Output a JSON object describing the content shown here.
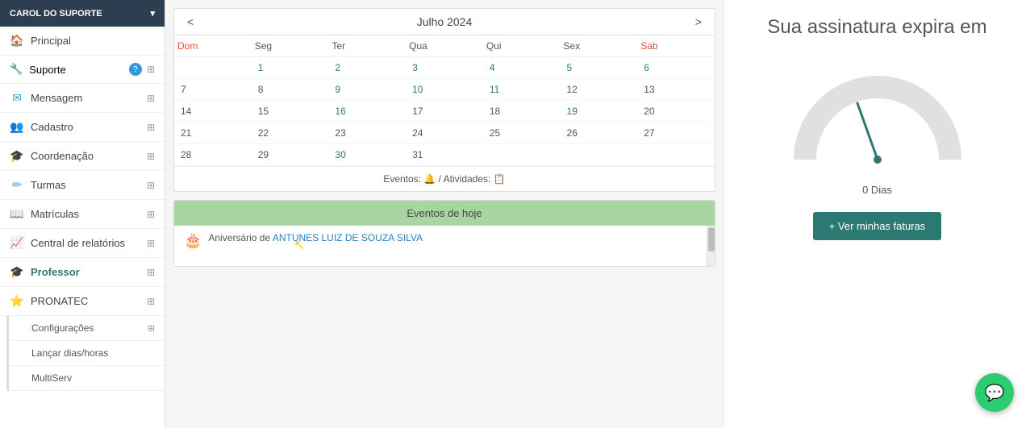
{
  "sidebar": {
    "user": {
      "name": "CAROL DO SUPORTE",
      "chevron": "▾"
    },
    "items": [
      {
        "id": "principal",
        "label": "Principal",
        "icon": "🏠",
        "expandable": false
      },
      {
        "id": "suporte",
        "label": "Suporte",
        "icon": "❓",
        "expandable": true
      },
      {
        "id": "mensagem",
        "label": "Mensagem",
        "icon": "✉",
        "expandable": true
      },
      {
        "id": "cadastro",
        "label": "Cadastro",
        "icon": "👥",
        "expandable": true
      },
      {
        "id": "coordenacao",
        "label": "Coordenação",
        "icon": "🎓",
        "expandable": true
      },
      {
        "id": "turmas",
        "label": "Turmas",
        "icon": "✏",
        "expandable": true
      },
      {
        "id": "matriculas",
        "label": "Matrículas",
        "icon": "📖",
        "expandable": true
      },
      {
        "id": "relatorios",
        "label": "Central de relatórios",
        "icon": "📈",
        "expandable": true
      },
      {
        "id": "professor",
        "label": "Professor",
        "icon": "🎓",
        "expandable": true
      },
      {
        "id": "pronatec",
        "label": "PRONATEC",
        "icon": "⭐",
        "expandable": true
      }
    ],
    "sub_items": [
      {
        "id": "configuracoes",
        "label": "Configurações",
        "expandable": true
      },
      {
        "id": "lancar-dias",
        "label": "Lançar dias/horas",
        "expandable": false
      },
      {
        "id": "multiserv",
        "label": "MultiServ",
        "expandable": false
      }
    ]
  },
  "calendar": {
    "title": "Julho 2024",
    "prev": "<",
    "next": ">",
    "days": [
      "Dom",
      "Seg",
      "Ter",
      "Qua",
      "Qui",
      "Sex",
      "Sab"
    ],
    "weeks": [
      [
        "",
        "1",
        "2",
        "3",
        "4",
        "5",
        "6"
      ],
      [
        "7",
        "8",
        "9",
        "10",
        "11",
        "12",
        "13"
      ],
      [
        "14",
        "15",
        "16",
        "17",
        "18",
        "19",
        "20"
      ],
      [
        "21",
        "22",
        "23",
        "24",
        "25",
        "26",
        "27"
      ],
      [
        "28",
        "29",
        "30",
        "31",
        "",
        "",
        ""
      ]
    ],
    "teal_days": [
      "1",
      "2",
      "3",
      "4",
      "5",
      "6",
      "9",
      "10",
      "11",
      "16",
      "19",
      "30"
    ],
    "footer_text": "Eventos:",
    "footer_atividades": "/ Atividades:"
  },
  "events": {
    "header": "Eventos de hoje",
    "items": [
      {
        "type": "birthday",
        "text": "Aniversário de",
        "name": "ANTUNES LUIZ DE SOUZA SILVA"
      }
    ]
  },
  "subscription": {
    "title": "Sua assinatura expira em",
    "days_label": "0 Dias",
    "button_label": "+ Ver minhas faturas"
  },
  "chat": {
    "icon": "💬"
  }
}
